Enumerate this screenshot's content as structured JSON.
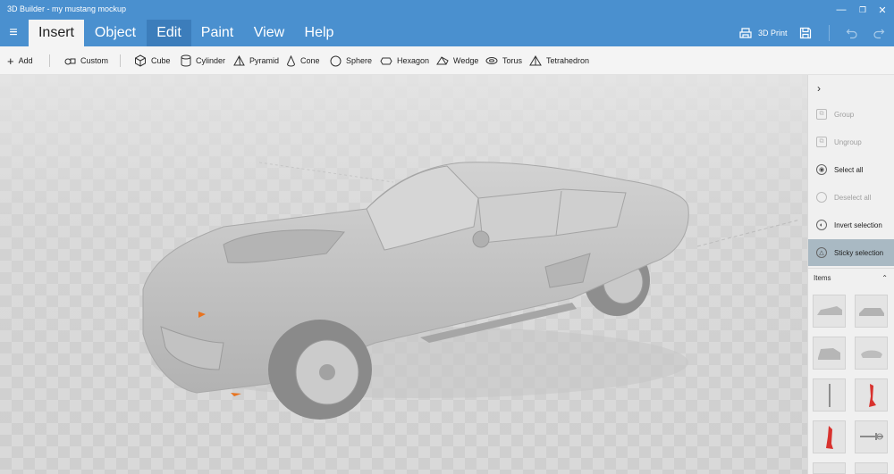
{
  "window": {
    "title": "3D Builder - my mustang mockup",
    "minimize_glyph": "—",
    "restore_glyph": "❐",
    "close_glyph": "✕"
  },
  "menu": {
    "hamburger_glyph": "≡",
    "tabs": [
      "Insert",
      "Object",
      "Edit",
      "Paint",
      "View",
      "Help"
    ],
    "print_label": "3D Print"
  },
  "toolbar": {
    "add_label": "Add",
    "custom_label": "Custom",
    "shapes": [
      "Cube",
      "Cylinder",
      "Pyramid",
      "Cone",
      "Sphere",
      "Hexagon",
      "Wedge",
      "Torus",
      "Tetrahedron"
    ]
  },
  "panel": {
    "expand_glyph": "›",
    "actions": [
      {
        "label": "Group",
        "state": "disabled"
      },
      {
        "label": "Ungroup",
        "state": "disabled"
      },
      {
        "label": "Select all",
        "state": "enabled"
      },
      {
        "label": "Deselect all",
        "state": "disabled"
      },
      {
        "label": "Invert selection",
        "state": "enabled"
      },
      {
        "label": "Sticky selection",
        "state": "active"
      }
    ],
    "items_label": "Items",
    "items_collapse_glyph": "⌃"
  },
  "colors": {
    "accent": "#4a90cf",
    "accent_selected": "#3c7dbb",
    "model_gray": "#bdbdbd",
    "part_red": "#d8322e",
    "marker_orange": "#e8731f"
  }
}
